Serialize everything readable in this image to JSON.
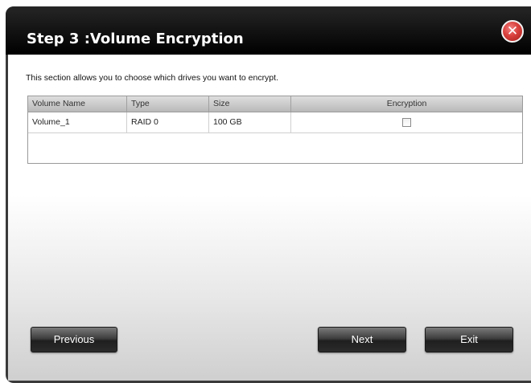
{
  "window": {
    "title": "Step 3 :Volume Encryption",
    "close_symbol": "✕"
  },
  "main": {
    "description": "This section allows you to choose which drives you want to encrypt."
  },
  "table": {
    "headers": {
      "volume_name": "Volume Name",
      "type": "Type",
      "size": "Size",
      "encryption": "Encryption"
    },
    "rows": [
      {
        "volume_name": "Volume_1",
        "type": "RAID 0",
        "size": "100 GB",
        "encryption_checked": false
      }
    ]
  },
  "buttons": {
    "previous": "Previous",
    "next": "Next",
    "exit": "Exit"
  },
  "colors": {
    "titlebar": "#000000",
    "close_button": "#d8403c",
    "button": "#2b2b2b"
  }
}
